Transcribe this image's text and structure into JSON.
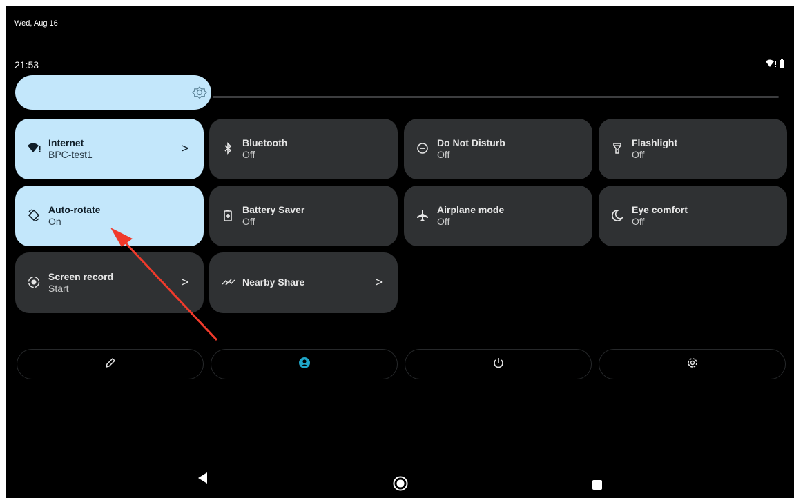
{
  "status": {
    "date": "Wed, Aug 16",
    "time": "21:53",
    "icons": [
      "wifi-warning-icon",
      "battery-icon"
    ]
  },
  "brightness": {
    "level": 0.23,
    "icon": "brightness-icon"
  },
  "tiles": [
    {
      "label": "Internet",
      "sub": "BPC-test1",
      "active": true,
      "chevron": true,
      "icon": "wifi-warning-icon"
    },
    {
      "label": "Bluetooth",
      "sub": "Off",
      "active": false,
      "icon": "bluetooth-icon"
    },
    {
      "label": "Do Not Disturb",
      "sub": "Off",
      "active": false,
      "icon": "dnd-icon"
    },
    {
      "label": "Flashlight",
      "sub": "Off",
      "active": false,
      "icon": "flashlight-icon"
    },
    {
      "label": "Auto-rotate",
      "sub": "On",
      "active": true,
      "icon": "rotate-icon"
    },
    {
      "label": "Battery Saver",
      "sub": "Off",
      "active": false,
      "icon": "battery-saver-icon"
    },
    {
      "label": "Airplane mode",
      "sub": "Off",
      "active": false,
      "icon": "airplane-icon"
    },
    {
      "label": "Eye comfort",
      "sub": "Off",
      "active": false,
      "icon": "moon-icon"
    },
    {
      "label": "Screen record",
      "sub": "Start",
      "active": false,
      "chevron": true,
      "icon": "screen-record-icon"
    },
    {
      "label": "Nearby Share",
      "active": false,
      "chevron": true,
      "icon": "nearby-share-icon"
    }
  ],
  "chevron": ">",
  "bottom_buttons": [
    "edit-icon",
    "user-icon",
    "power-icon",
    "settings-icon"
  ],
  "nav": [
    "back-icon",
    "home-icon",
    "recents-icon"
  ],
  "colors": {
    "tile_active": "#c3e7fb",
    "tile_inactive": "#2f3133",
    "accent": "#1fa7c9",
    "annotation_arrow": "#f03a2b"
  }
}
